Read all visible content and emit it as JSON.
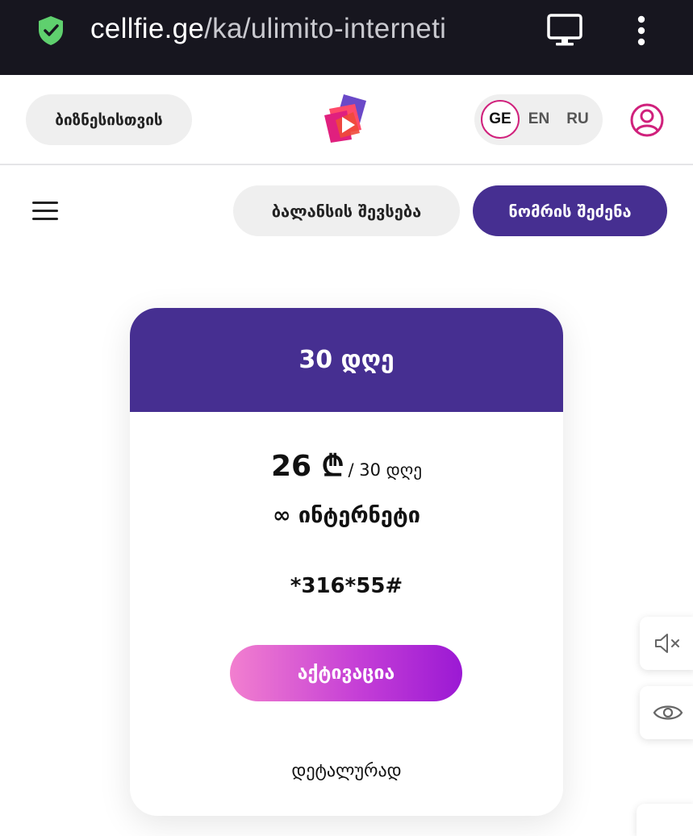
{
  "browser": {
    "url_domain": "cellfie.ge",
    "url_path": "/ka/ulimito-interneti",
    "icons": [
      "shield-check-icon",
      "desktop-icon",
      "more-vert-icon"
    ]
  },
  "header": {
    "business_label": "ბიზნესისთვის",
    "logo": "cellfie-logo",
    "languages": [
      {
        "code": "GE",
        "active": true
      },
      {
        "code": "EN",
        "active": false
      },
      {
        "code": "RU",
        "active": false
      }
    ],
    "user_icon": "user-icon"
  },
  "nav": {
    "menu_icon": "hamburger-menu-icon",
    "balance_label": "ბალანსის შევსება",
    "number_label": "ნომრის შეძენა"
  },
  "card": {
    "title": "30 დღე",
    "price": "26 ₾",
    "period": "/ 30 დღე",
    "feature": "∞ ინტერნეტი",
    "code": "*316*55#",
    "activate_label": "აქტივაცია",
    "details_label": "დეტალურად"
  },
  "side": {
    "icons": [
      "speaker-mute-icon",
      "eye-icon"
    ]
  },
  "colors": {
    "brand_purple": "#462f91",
    "accent_pink": "#d0217c",
    "button_gradient_start": "#f27fcf",
    "button_gradient_end": "#9b19d4",
    "urlbar_bg": "#17161f"
  }
}
